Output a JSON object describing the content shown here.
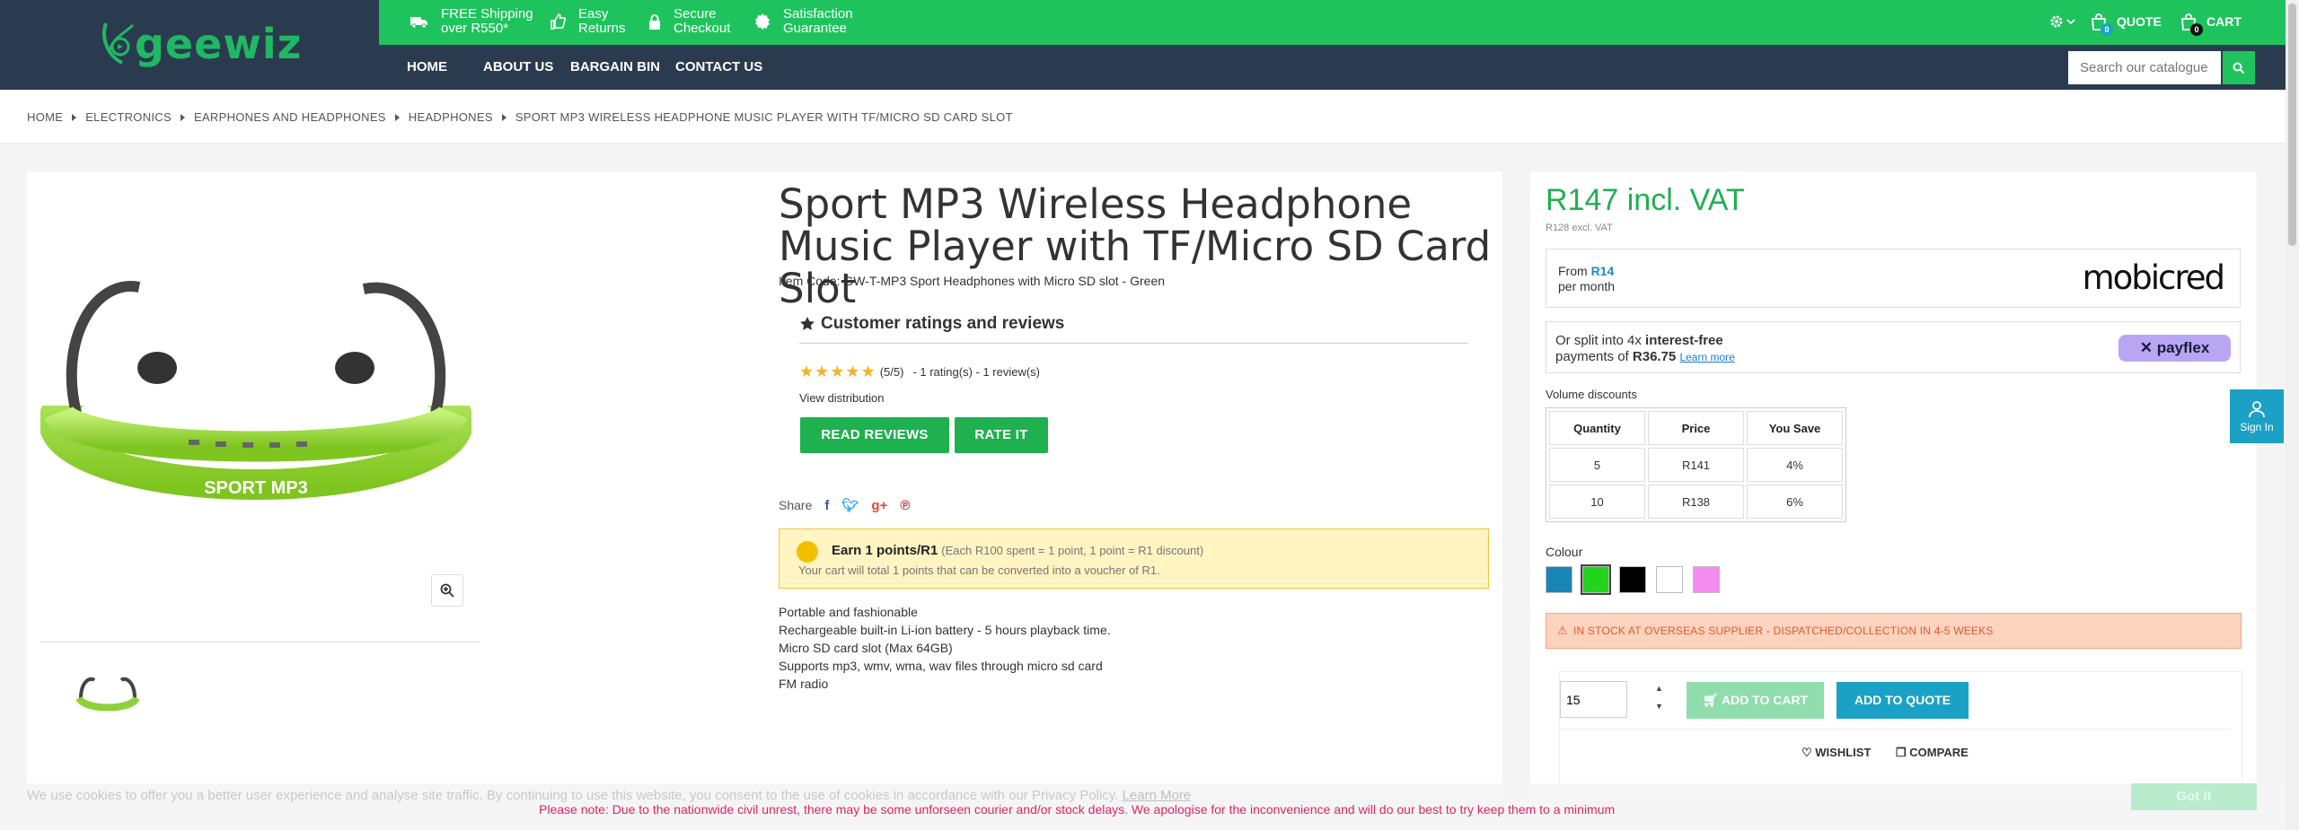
{
  "header": {
    "brand": "geewiz",
    "perks": [
      {
        "line1": "FREE Shipping",
        "line2": "over R550*",
        "icon": "truck-icon"
      },
      {
        "line1": "Easy",
        "line2": "Returns",
        "icon": "thumbs-up-icon"
      },
      {
        "line1": "Secure",
        "line2": "Checkout",
        "icon": "lock-icon"
      },
      {
        "line1": "Satisfaction",
        "line2": "Guarantee",
        "icon": "badge-icon"
      }
    ],
    "nav": [
      "HOME",
      "ABOUT US",
      "BARGAIN BIN",
      "CONTACT US"
    ],
    "quote_label": "QUOTE",
    "quote_count": "0",
    "cart_label": "CART",
    "cart_count": "0",
    "search_placeholder": "Search our catalogue"
  },
  "breadcrumb": [
    "HOME",
    "ELECTRONICS",
    "EARPHONES AND HEADPHONES",
    "HEADPHONES",
    "SPORT MP3 WIRELESS HEADPHONE MUSIC PLAYER WITH TF/MICRO SD CARD SLOT"
  ],
  "product": {
    "title": "Sport MP3 Wireless Headphone Music Player with TF/Micro SD Card Slot",
    "item_code_label": "Item Code:",
    "item_code": "GW-T-MP3 Sport Headphones with Micro SD slot - Green",
    "image_text": "SPORT MP3",
    "reviews": {
      "heading": "Customer ratings and reviews",
      "score": "(5/5)",
      "summary": "- 1 rating(s) - 1 review(s)",
      "view_distribution": "View distribution",
      "read_reviews": "READ REVIEWS",
      "rate_it": "RATE IT",
      "stars": 5
    },
    "share_label": "Share",
    "points": {
      "headline": "Earn 1 points/R1",
      "detail": "(Each R100 spent = 1 point, 1 point = R1 discount)",
      "line2": "Your cart will total 1 points that can be converted into a voucher of R1."
    },
    "description": [
      "Portable and fashionable",
      "Rechargeable built-in Li-ion battery - 5 hours playback time.",
      "Micro SD card slot (Max 64GB)",
      "Supports mp3, wmv, wma, wav files through micro sd card",
      "FM radio"
    ]
  },
  "purchase": {
    "price": "R147 incl. VAT",
    "price_excl": "R128 excl. VAT",
    "mobicred_from": "From",
    "mobicred_amount": "R14",
    "mobicred_per": "per month",
    "mobicred_logo": "mobicred",
    "payflex_line1_pre": "Or split into 4x",
    "payflex_line1_bold": "interest-free",
    "payflex_line2_pre": "payments of",
    "payflex_amount": "R36.75",
    "payflex_learn": "Learn more",
    "payflex_logo": "payflex",
    "volume_title": "Volume discounts",
    "volume_headers": [
      "Quantity",
      "Price",
      "You Save"
    ],
    "volume_rows": [
      [
        "5",
        "R141",
        "4%"
      ],
      [
        "10",
        "R138",
        "6%"
      ]
    ],
    "colour_title": "Colour",
    "colours": [
      "#1a86b8",
      "#22d41c",
      "#000000",
      "#ffffff",
      "#f58cf0"
    ],
    "stock": "IN STOCK AT OVERSEAS SUPPLIER - DISPATCHED/COLLECTION IN 4-5 WEEKS",
    "quantity": "15",
    "add_to_cart": "ADD TO CART",
    "add_to_quote": "ADD TO QUOTE",
    "wishlist": "WISHLIST",
    "compare": "COMPARE",
    "sign_in": "Sign In"
  },
  "cookie": {
    "text": "We use cookies to offer you a better user experience and analyse site traffic. By continuing to use this website, you consent to the use of cookies in accordance with our Privacy Policy.",
    "learn_more": "Learn More",
    "ok": "Got it",
    "notice": "Please note: Due to the nationwide civil unrest, there may be some unforseen courier and/or stock delays. We apologise for the inconvenience and will do our best to try keep them to a minimum"
  },
  "colors": {
    "brand_green": "#1fc35d",
    "navy": "#2a3b50",
    "price_green": "#1fb050",
    "blue_button": "#1ba1c5"
  }
}
